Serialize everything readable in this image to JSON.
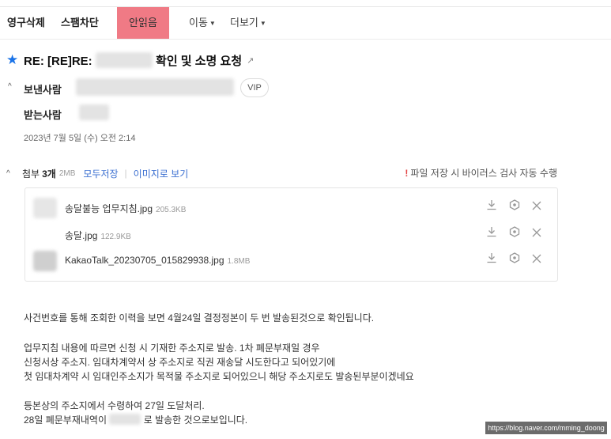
{
  "toolbar": {
    "delete": "영구삭제",
    "spam": "스팸차단",
    "unread": "안읽음",
    "move": "이동",
    "more": "더보기"
  },
  "mail": {
    "subject_prefix": "RE: [RE]RE:",
    "subject_suffix": "확인 및 소명 요청",
    "sender_label": "보낸사람",
    "vip": "VIP",
    "recipient_label": "받는사람",
    "date": "2023년 7월 5일 (수) 오전 2:14"
  },
  "attachments": {
    "label": "첨부",
    "count": "3개",
    "total_size": "2MB",
    "save_all": "모두저장",
    "view_as_image": "이미지로 보기",
    "scan_notice": "파일 저장 시 바이러스 검사 자동 수행",
    "files": [
      {
        "name": "송달불능 업무지침.jpg",
        "size": "205.3KB"
      },
      {
        "name": "송달.jpg",
        "size": "122.9KB"
      },
      {
        "name": "KakaoTalk_20230705_015829938.jpg",
        "size": "1.8MB"
      }
    ]
  },
  "body": {
    "line1": "사건번호를 통해 조회한 이력을 보면 4월24일 결정정본이 두 번 발송된것으로 확인됩니다.",
    "line2": "업무지침 내용에 따르면 신청 시 기재한 주소지로 발송. 1차 폐문부재일 경우",
    "line3": "신청서상 주소지. 임대차계약서 상 주소지로 직권 재송달 시도한다고 되어있기에",
    "line4": "첫 임대차계약 시 임대인주소지가 목적물 주소지로 되어있으니 해당 주소지로도 발송된부분이겠네요",
    "line5": "등본상의 주소지에서 수령하여 27일 도달처리.",
    "line6a": "28일 폐문부재내역이",
    "line6b": "로 발송한 것으로보입니다."
  },
  "watermark": "https://blog.naver.com/mming_doong",
  "colors": {
    "unread_bg": "#f07a85",
    "star": "#1a73e8",
    "link": "#3b6fd1"
  }
}
